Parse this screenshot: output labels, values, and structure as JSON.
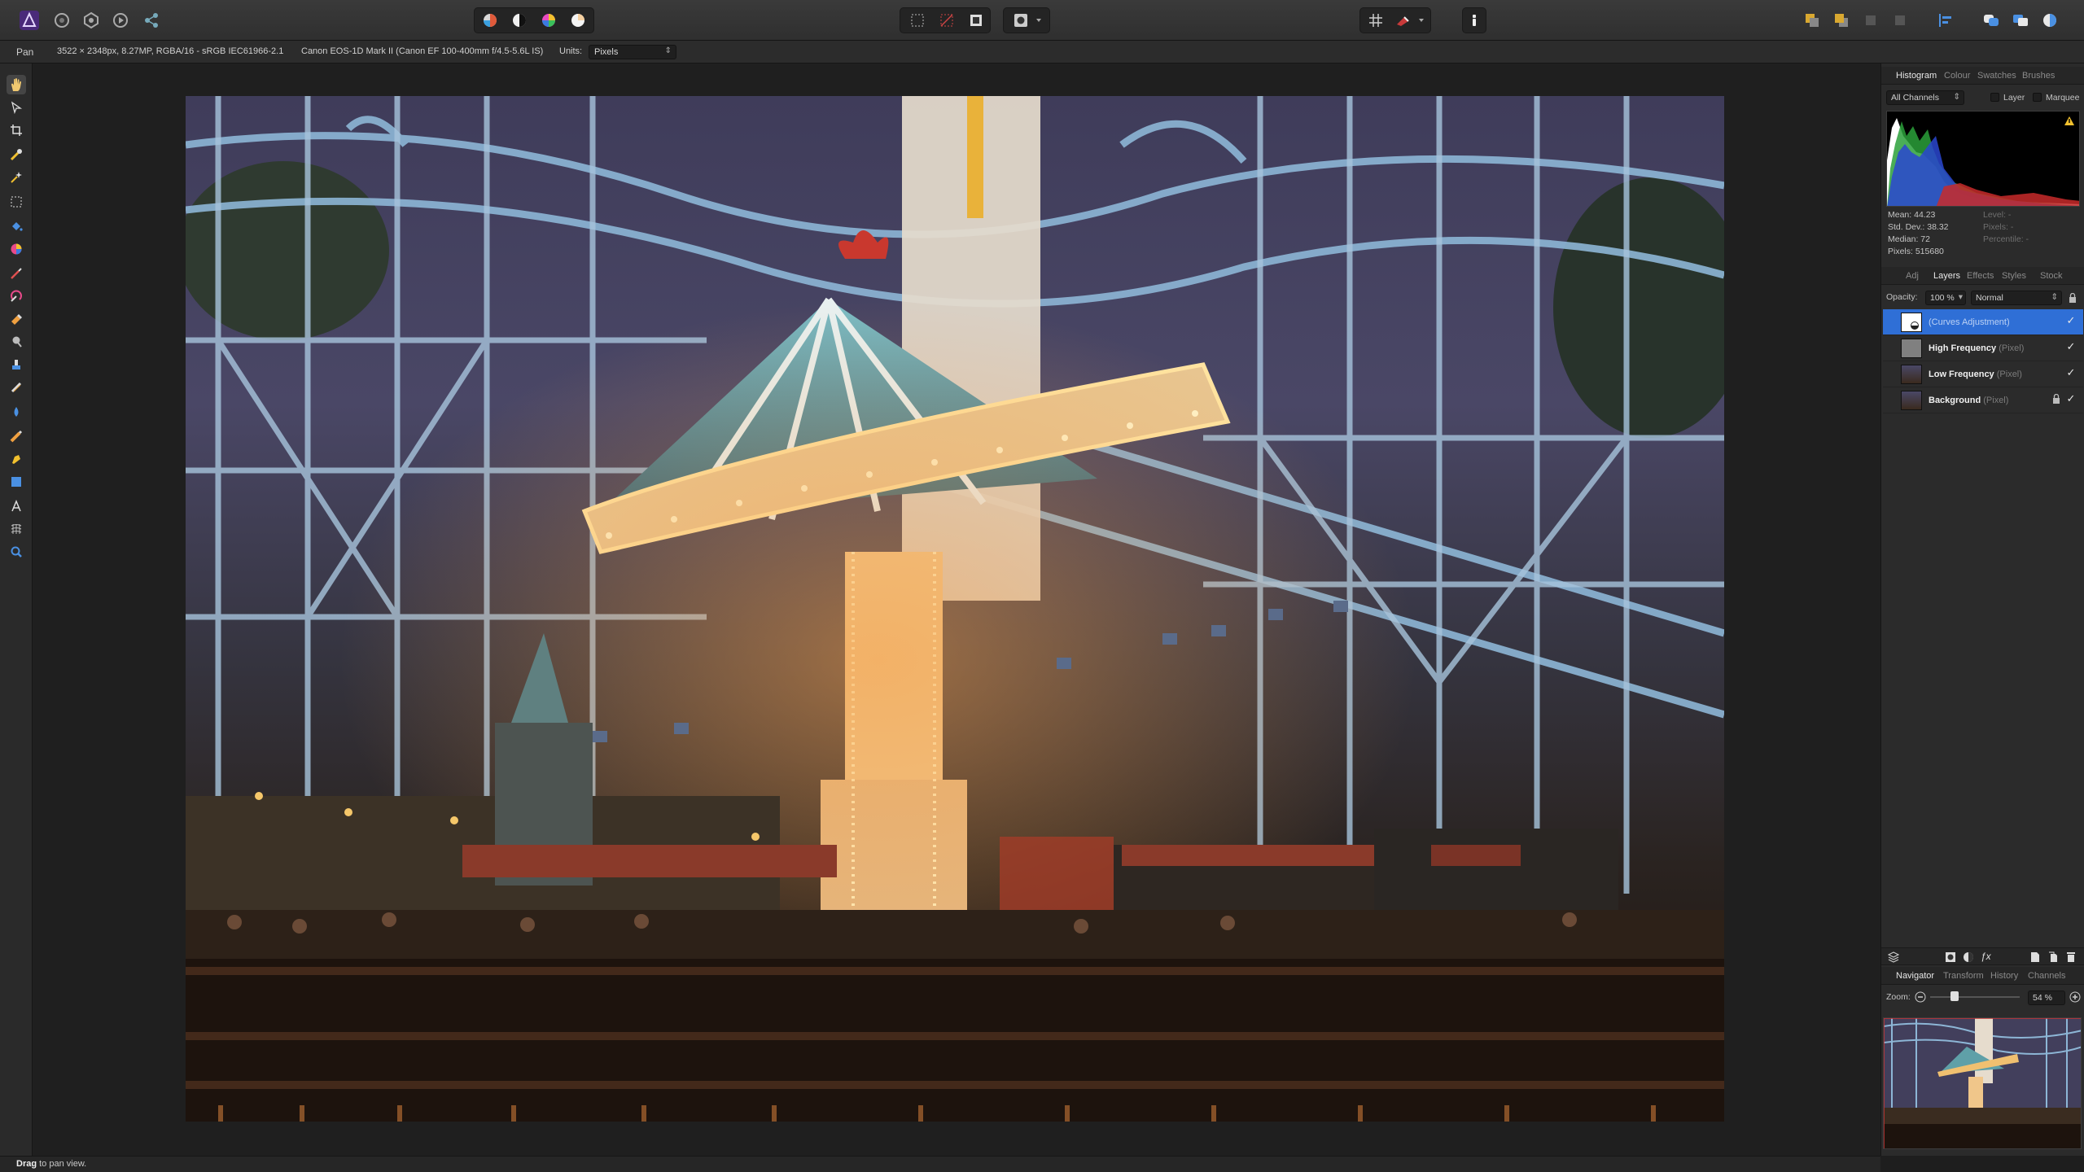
{
  "context_bar": {
    "tool_name": "Pan",
    "doc_info": "3522 × 2348px, 8.27MP, RGBA/16 - sRGB IEC61966-2.1",
    "camera_info": "Canon EOS-1D Mark II (Canon EF 100-400mm f/4.5-5.6L IS)",
    "units_label": "Units:",
    "units_value": "Pixels"
  },
  "top_panel": {
    "tabs": [
      "Histogram",
      "Colour",
      "Swatches",
      "Brushes"
    ],
    "channel_select": "All Channels",
    "layer_checkbox_label": "Layer",
    "marquee_checkbox_label": "Marquee",
    "stats": {
      "mean": "Mean: 44.23",
      "std_dev": "Std. Dev.: 38.32",
      "median": "Median: 72",
      "pixels": "Pixels: 515680",
      "level": "Level: -",
      "pixels_right": "Pixels: -",
      "percentile": "Percentile: -"
    }
  },
  "layers_panel": {
    "tabs": [
      "Adj",
      "Layers",
      "Effects",
      "Styles",
      "Stock"
    ],
    "opacity_label": "Opacity:",
    "opacity_value": "100 %",
    "blend_mode": "Normal",
    "layers": [
      {
        "name": "",
        "type": "(Curves Adjustment)"
      },
      {
        "name": "High Frequency",
        "type": "(Pixel)"
      },
      {
        "name": "Low Frequency",
        "type": "(Pixel)"
      },
      {
        "name": "Background",
        "type": "(Pixel)"
      }
    ]
  },
  "navigator_panel": {
    "tabs": [
      "Navigator",
      "Transform",
      "History",
      "Channels"
    ],
    "zoom_label": "Zoom:",
    "zoom_value": "54 %"
  },
  "status_bar": {
    "bold": "Drag",
    "rest": " to pan view."
  },
  "colors": {
    "accent_blue": "#2f6fd6",
    "app_bg": "#1e1e1e",
    "panel_bg": "#2b2b2b"
  }
}
